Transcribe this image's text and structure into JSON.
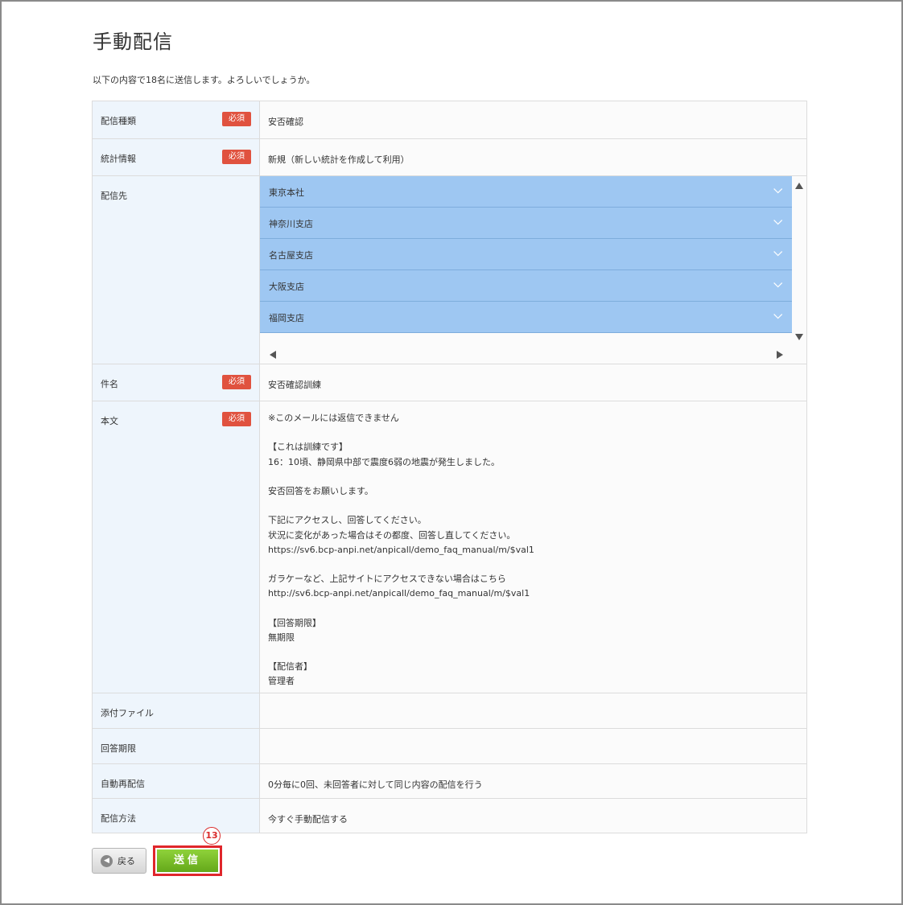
{
  "page": {
    "title": "手動配信",
    "intro": "以下の内容で18名に送信します。よろしいでしょうか。"
  },
  "required_label": "必須",
  "fields": {
    "type": {
      "label": "配信種類",
      "value": "安否確認"
    },
    "stats": {
      "label": "統計情報",
      "value": "新規（新しい統計を作成して利用）"
    },
    "destination": {
      "label": "配信先",
      "items": [
        "東京本社",
        "神奈川支店",
        "名古屋支店",
        "大阪支店",
        "福岡支店"
      ]
    },
    "subject": {
      "label": "件名",
      "value": "安否確認訓練"
    },
    "body": {
      "label": "本文",
      "lines": [
        "※このメールには返信できません",
        "",
        "【これは訓練です】",
        "16：10頃、静岡県中部で震度6弱の地震が発生しました。",
        "",
        "安否回答をお願いします。",
        "",
        "下記にアクセスし、回答してください。",
        "状況に変化があった場合はその都度、回答し直してください。",
        "https://sv6.bcp-anpi.net/anpicall/demo_faq_manual/m/$val1",
        "",
        "ガラケーなど、上記サイトにアクセスできない場合はこちら",
        "http://sv6.bcp-anpi.net/anpicall/demo_faq_manual/m/$val1",
        "",
        "【回答期限】",
        "無期限",
        "",
        "【配信者】",
        "管理者"
      ]
    },
    "attachment": {
      "label": "添付ファイル",
      "value": ""
    },
    "deadline": {
      "label": "回答期限",
      "value": ""
    },
    "resend": {
      "label": "自動再配信",
      "value": "0分毎に0回、未回答者に対して同じ内容の配信を行う"
    },
    "method": {
      "label": "配信方法",
      "value": "今すぐ手動配信する"
    }
  },
  "buttons": {
    "back": "戻る",
    "send": "送信"
  },
  "annotation": {
    "step": "13",
    "color": "#d92a2a"
  },
  "colors": {
    "required_badge": "#e0523f",
    "destination_item": "#9ec7f2",
    "send_button": "#72b622"
  }
}
